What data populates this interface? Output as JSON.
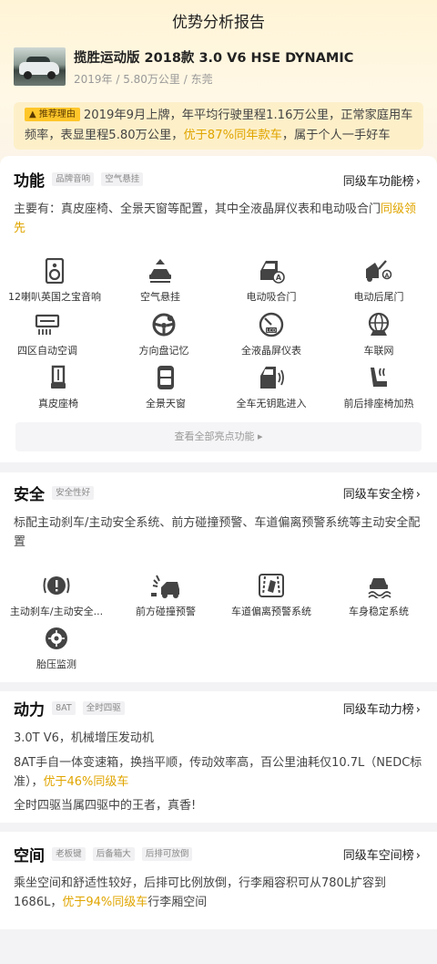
{
  "page": {
    "title": "优势分析报告"
  },
  "car": {
    "name": "揽胜运动版 2018款 3.0 V6 HSE DYNAMIC",
    "meta": "2019年 / 5.80万公里 / 东莞"
  },
  "reason": {
    "badge": "推荐理由",
    "text_1": "2019年9月上牌，年平均行驶里程1.16万公里，正常家庭用车频率，表显里程5.80万公里，",
    "highlight": "优于87%同年款车",
    "text_2": "，属于个人一手好车"
  },
  "features": {
    "title": "功能",
    "tags": [
      "品牌音响",
      "空气悬挂"
    ],
    "rank_link": "同级车功能榜",
    "desc_1": "主要有：真皮座椅、全景天窗等配置，其中全液晶屏仪表和电动吸合门",
    "desc_highlight": "同级领先",
    "items": [
      {
        "label": "12喇叭英国之宝音响",
        "icon": "speaker-icon"
      },
      {
        "label": "空气悬挂",
        "icon": "air-suspension-icon"
      },
      {
        "label": "电动吸合门",
        "icon": "soft-close-door-icon"
      },
      {
        "label": "电动后尾门",
        "icon": "power-tailgate-icon"
      },
      {
        "label": "四区自动空调",
        "icon": "climate-control-icon"
      },
      {
        "label": "方向盘记忆",
        "icon": "steering-wheel-icon"
      },
      {
        "label": "全液晶屏仪表",
        "icon": "lcd-gauge-icon"
      },
      {
        "label": "车联网",
        "icon": "connected-car-icon"
      },
      {
        "label": "真皮座椅",
        "icon": "leather-seat-icon"
      },
      {
        "label": "全景天窗",
        "icon": "panoramic-sunroof-icon"
      },
      {
        "label": "全车无钥匙进入",
        "icon": "keyless-entry-icon"
      },
      {
        "label": "前后排座椅加热",
        "icon": "seat-heating-icon"
      }
    ],
    "more_label": "查看全部亮点功能 ▸"
  },
  "safety": {
    "title": "安全",
    "tags": [
      "安全性好"
    ],
    "rank_link": "同级车安全榜",
    "desc": "标配主动刹车/主动安全系统、前方碰撞预警、车道偏离预警系统等主动安全配置",
    "items": [
      {
        "label": "主动刹车/主动安全...",
        "icon": "active-brake-icon"
      },
      {
        "label": "前方碰撞预警",
        "icon": "collision-warning-icon"
      },
      {
        "label": "车道偏离预警系统",
        "icon": "lane-departure-icon"
      },
      {
        "label": "车身稳定系统",
        "icon": "stability-control-icon"
      },
      {
        "label": "胎压监测",
        "icon": "tire-pressure-icon"
      }
    ]
  },
  "power": {
    "title": "动力",
    "tags": [
      "8AT",
      "全时四驱"
    ],
    "rank_link": "同级车动力榜",
    "line_1": "3.0T V6，机械增压发动机",
    "line_2a": "8AT手自一体变速箱，换挡平顺，传动效率高，百公里油耗仅10.7L（NEDC标准），",
    "line_2_highlight": "优于46%同级车",
    "line_3": "全时四驱当属四驱中的王者，真香!"
  },
  "space": {
    "title": "空间",
    "tags": [
      "老板键",
      "后备箱大",
      "后排可放倒"
    ],
    "rank_link": "同级车空间榜",
    "text_1": "乘坐空间和舒适性较好，后排可比例放倒，行李厢容积可从780L扩容到1686L，",
    "highlight": "优于94%同级车",
    "text_2": "行李厢空间"
  },
  "colors": {
    "accent": "#e0a500",
    "badge": "#ffc62a",
    "icon": "#444444"
  }
}
